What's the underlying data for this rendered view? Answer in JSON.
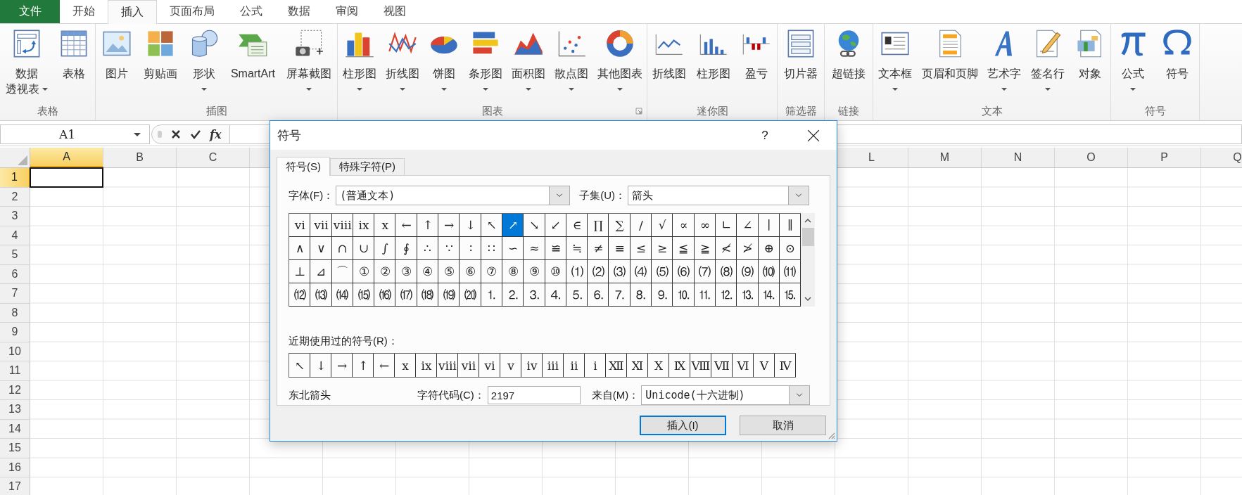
{
  "ribbon_tabs": [
    {
      "label": "文件",
      "kind": "file"
    },
    {
      "label": "开始",
      "kind": "tab",
      "selected": false
    },
    {
      "label": "插入",
      "kind": "tab",
      "selected": true
    },
    {
      "label": "页面布局",
      "kind": "tab",
      "selected": false
    },
    {
      "label": "公式",
      "kind": "tab",
      "selected": false
    },
    {
      "label": "数据",
      "kind": "tab",
      "selected": false
    },
    {
      "label": "审阅",
      "kind": "tab",
      "selected": false
    },
    {
      "label": "视图",
      "kind": "tab",
      "selected": false
    }
  ],
  "ribbon_groups": [
    {
      "label": "表格",
      "buttons": [
        {
          "label": "数据",
          "label_2": "透视表",
          "dropdown": true
        },
        {
          "label": "表格",
          "dropdown": false
        }
      ]
    },
    {
      "label": "插图",
      "buttons": [
        {
          "label": "图片",
          "dropdown": false
        },
        {
          "label": "剪贴画",
          "dropdown": false
        },
        {
          "label": "形状",
          "dropdown": true
        },
        {
          "label": "SmartArt",
          "dropdown": false
        },
        {
          "label": "屏幕截图",
          "dropdown": true
        }
      ]
    },
    {
      "label": "图表",
      "launcher": true,
      "buttons": [
        {
          "label": "柱形图",
          "dropdown": true
        },
        {
          "label": "折线图",
          "dropdown": true
        },
        {
          "label": "饼图",
          "dropdown": true
        },
        {
          "label": "条形图",
          "dropdown": true
        },
        {
          "label": "面积图",
          "dropdown": true
        },
        {
          "label": "散点图",
          "dropdown": true
        },
        {
          "label": "其他图表",
          "dropdown": true
        }
      ]
    },
    {
      "label": "迷你图",
      "buttons": [
        {
          "label": "折线图",
          "dropdown": false
        },
        {
          "label": "柱形图",
          "dropdown": false
        },
        {
          "label": "盈亏",
          "dropdown": false
        }
      ]
    },
    {
      "label": "筛选器",
      "buttons": [
        {
          "label": "切片器",
          "dropdown": false
        }
      ]
    },
    {
      "label": "链接",
      "buttons": [
        {
          "label": "超链接",
          "dropdown": false
        }
      ]
    },
    {
      "label": "文本",
      "buttons": [
        {
          "label": "文本框",
          "dropdown": true
        },
        {
          "label": "页眉和页脚",
          "dropdown": false
        },
        {
          "label": "艺术字",
          "dropdown": true
        },
        {
          "label": "签名行",
          "dropdown": true
        },
        {
          "label": "对象",
          "dropdown": false
        }
      ]
    },
    {
      "label": "符号",
      "buttons": [
        {
          "label": "公式",
          "dropdown": true
        },
        {
          "label": "符号",
          "dropdown": false
        }
      ]
    }
  ],
  "formula_bar": {
    "name_box": "A1",
    "fx": "fx"
  },
  "sheet": {
    "columns_left": [
      {
        "label": "A",
        "selected": true
      },
      {
        "label": "B",
        "selected": false
      },
      {
        "label": "C",
        "selected": false
      }
    ],
    "columns_right": [
      {
        "label": "L",
        "selected": false
      },
      {
        "label": "M",
        "selected": false
      },
      {
        "label": "N",
        "selected": false
      },
      {
        "label": "O",
        "selected": false
      },
      {
        "label": "P",
        "selected": false
      },
      {
        "label": "Q",
        "selected": false
      }
    ],
    "rows": [
      {
        "label": "1",
        "selected": true
      },
      {
        "label": "2",
        "selected": false
      },
      {
        "label": "3",
        "selected": false
      },
      {
        "label": "4",
        "selected": false
      },
      {
        "label": "5",
        "selected": false
      },
      {
        "label": "6",
        "selected": false
      },
      {
        "label": "7",
        "selected": false
      },
      {
        "label": "8",
        "selected": false
      },
      {
        "label": "9",
        "selected": false
      },
      {
        "label": "10",
        "selected": false
      },
      {
        "label": "11",
        "selected": false
      },
      {
        "label": "12",
        "selected": false
      },
      {
        "label": "13",
        "selected": false
      },
      {
        "label": "14",
        "selected": false
      },
      {
        "label": "15",
        "selected": false
      },
      {
        "label": "16",
        "selected": false
      },
      {
        "label": "17",
        "selected": false
      }
    ]
  },
  "dialog": {
    "title": "符号",
    "help": "?",
    "tabs": [
      {
        "label": "符号(S)",
        "selected": true
      },
      {
        "label": "特殊字符(P)",
        "selected": false
      }
    ],
    "font_label": "字体(F)：",
    "font_value": "(普通文本)",
    "subset_label": "子集(U)：",
    "subset_value": "箭头",
    "symbol_rows": [
      {
        "cells": [
          {
            "char": "ⅵ",
            "selected": false
          },
          {
            "char": "ⅶ",
            "selected": false
          },
          {
            "char": "ⅷ",
            "selected": false
          },
          {
            "char": "ⅸ",
            "selected": false
          },
          {
            "char": "ⅹ",
            "selected": false
          },
          {
            "char": "←",
            "selected": false
          },
          {
            "char": "↑",
            "selected": false
          },
          {
            "char": "→",
            "selected": false
          },
          {
            "char": "↓",
            "selected": false
          },
          {
            "char": "↖",
            "selected": false
          },
          {
            "char": "↗",
            "selected": true
          },
          {
            "char": "↘",
            "selected": false
          },
          {
            "char": "↙",
            "selected": false
          },
          {
            "char": "∈",
            "selected": false
          },
          {
            "char": "∏",
            "selected": false
          },
          {
            "char": "∑",
            "selected": false
          },
          {
            "char": "/",
            "selected": false
          },
          {
            "char": "√",
            "selected": false
          },
          {
            "char": "∝",
            "selected": false
          },
          {
            "char": "∞",
            "selected": false
          },
          {
            "char": "∟",
            "selected": false
          },
          {
            "char": "∠",
            "selected": false
          },
          {
            "char": "∣",
            "selected": false
          },
          {
            "char": "∥",
            "selected": false
          }
        ]
      },
      {
        "cells": [
          {
            "char": "∧",
            "selected": false
          },
          {
            "char": "∨",
            "selected": false
          },
          {
            "char": "∩",
            "selected": false
          },
          {
            "char": "∪",
            "selected": false
          },
          {
            "char": "∫",
            "selected": false
          },
          {
            "char": "∮",
            "selected": false
          },
          {
            "char": "∴",
            "selected": false
          },
          {
            "char": "∵",
            "selected": false
          },
          {
            "char": "∶",
            "selected": false
          },
          {
            "char": "∷",
            "selected": false
          },
          {
            "char": "∽",
            "selected": false
          },
          {
            "char": "≈",
            "selected": false
          },
          {
            "char": "≌",
            "selected": false
          },
          {
            "char": "≒",
            "selected": false
          },
          {
            "char": "≠",
            "selected": false
          },
          {
            "char": "≡",
            "selected": false
          },
          {
            "char": "≤",
            "selected": false
          },
          {
            "char": "≥",
            "selected": false
          },
          {
            "char": "≦",
            "selected": false
          },
          {
            "char": "≧",
            "selected": false
          },
          {
            "char": "≮",
            "selected": false
          },
          {
            "char": "≯",
            "selected": false
          },
          {
            "char": "⊕",
            "selected": false
          },
          {
            "char": "⊙",
            "selected": false
          }
        ]
      },
      {
        "cells": [
          {
            "char": "⊥",
            "selected": false
          },
          {
            "char": "⊿",
            "selected": false
          },
          {
            "char": "⌒",
            "selected": false
          },
          {
            "char": "①",
            "selected": false
          },
          {
            "char": "②",
            "selected": false
          },
          {
            "char": "③",
            "selected": false
          },
          {
            "char": "④",
            "selected": false
          },
          {
            "char": "⑤",
            "selected": false
          },
          {
            "char": "⑥",
            "selected": false
          },
          {
            "char": "⑦",
            "selected": false
          },
          {
            "char": "⑧",
            "selected": false
          },
          {
            "char": "⑨",
            "selected": false
          },
          {
            "char": "⑩",
            "selected": false
          },
          {
            "char": "⑴",
            "selected": false
          },
          {
            "char": "⑵",
            "selected": false
          },
          {
            "char": "⑶",
            "selected": false
          },
          {
            "char": "⑷",
            "selected": false
          },
          {
            "char": "⑸",
            "selected": false
          },
          {
            "char": "⑹",
            "selected": false
          },
          {
            "char": "⑺",
            "selected": false
          },
          {
            "char": "⑻",
            "selected": false
          },
          {
            "char": "⑼",
            "selected": false
          },
          {
            "char": "⑽",
            "selected": false
          },
          {
            "char": "⑾",
            "selected": false
          }
        ]
      },
      {
        "cells": [
          {
            "char": "⑿",
            "selected": false
          },
          {
            "char": "⒀",
            "selected": false
          },
          {
            "char": "⒁",
            "selected": false
          },
          {
            "char": "⒂",
            "selected": false
          },
          {
            "char": "⒃",
            "selected": false
          },
          {
            "char": "⒄",
            "selected": false
          },
          {
            "char": "⒅",
            "selected": false
          },
          {
            "char": "⒆",
            "selected": false
          },
          {
            "char": "⒇",
            "selected": false
          },
          {
            "char": "⒈",
            "selected": false
          },
          {
            "char": "⒉",
            "selected": false
          },
          {
            "char": "⒊",
            "selected": false
          },
          {
            "char": "⒋",
            "selected": false
          },
          {
            "char": "⒌",
            "selected": false
          },
          {
            "char": "⒍",
            "selected": false
          },
          {
            "char": "⒎",
            "selected": false
          },
          {
            "char": "⒏",
            "selected": false
          },
          {
            "char": "⒐",
            "selected": false
          },
          {
            "char": "⒑",
            "selected": false
          },
          {
            "char": "⒒",
            "selected": false
          },
          {
            "char": "⒓",
            "selected": false
          },
          {
            "char": "⒔",
            "selected": false
          },
          {
            "char": "⒕",
            "selected": false
          },
          {
            "char": "⒖",
            "selected": false
          }
        ]
      }
    ],
    "recent_label": "近期使用过的符号(R)：",
    "recent": [
      "↖",
      "↓",
      "→",
      "↑",
      "←",
      "ⅹ",
      "ⅸ",
      "ⅷ",
      "ⅶ",
      "ⅵ",
      "ⅴ",
      "ⅳ",
      "ⅲ",
      "ⅱ",
      "ⅰ",
      "Ⅻ",
      "Ⅺ",
      "Ⅹ",
      "Ⅸ",
      "Ⅷ",
      "Ⅶ",
      "Ⅵ",
      "Ⅴ",
      "Ⅳ"
    ],
    "char_name": "东北箭头",
    "code_label": "字符代码(C)：",
    "code_value": "2197",
    "from_label": "来自(M)：",
    "from_value": "Unicode(十六进制)",
    "buttons": [
      {
        "label": "插入(I)",
        "kind": "primary"
      },
      {
        "label": "取消",
        "kind": "normal"
      }
    ]
  }
}
